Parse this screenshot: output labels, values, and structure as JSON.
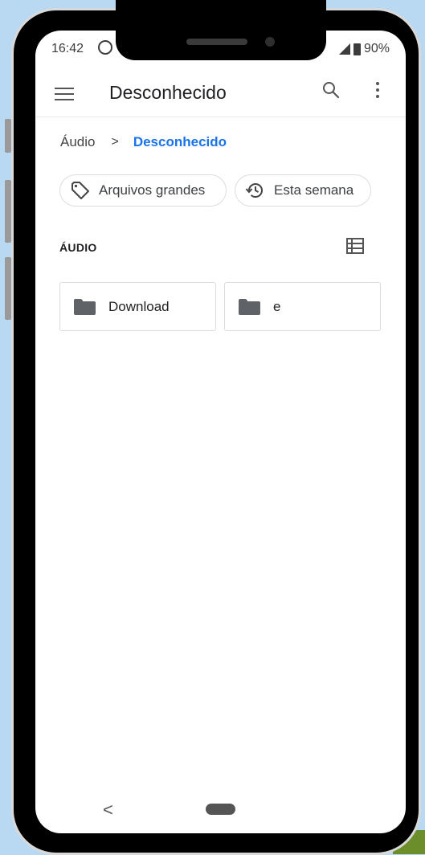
{
  "status_bar": {
    "time": "16:42",
    "battery": "90%"
  },
  "app_bar": {
    "title": "Desconhecido"
  },
  "breadcrumb": {
    "root": "Áudio",
    "separator": ">",
    "current": "Desconhecido"
  },
  "chips": [
    {
      "label": "Arquivos grandes",
      "icon": "tag-icon"
    },
    {
      "label": "Esta semana",
      "icon": "history-icon"
    }
  ],
  "section": {
    "label": "ÁUDIO"
  },
  "folders": [
    {
      "name": "Download"
    },
    {
      "name": "e"
    }
  ],
  "nav": {
    "back": "<"
  },
  "colors": {
    "accent": "#1a73e8",
    "background": "#b9d9f3"
  }
}
